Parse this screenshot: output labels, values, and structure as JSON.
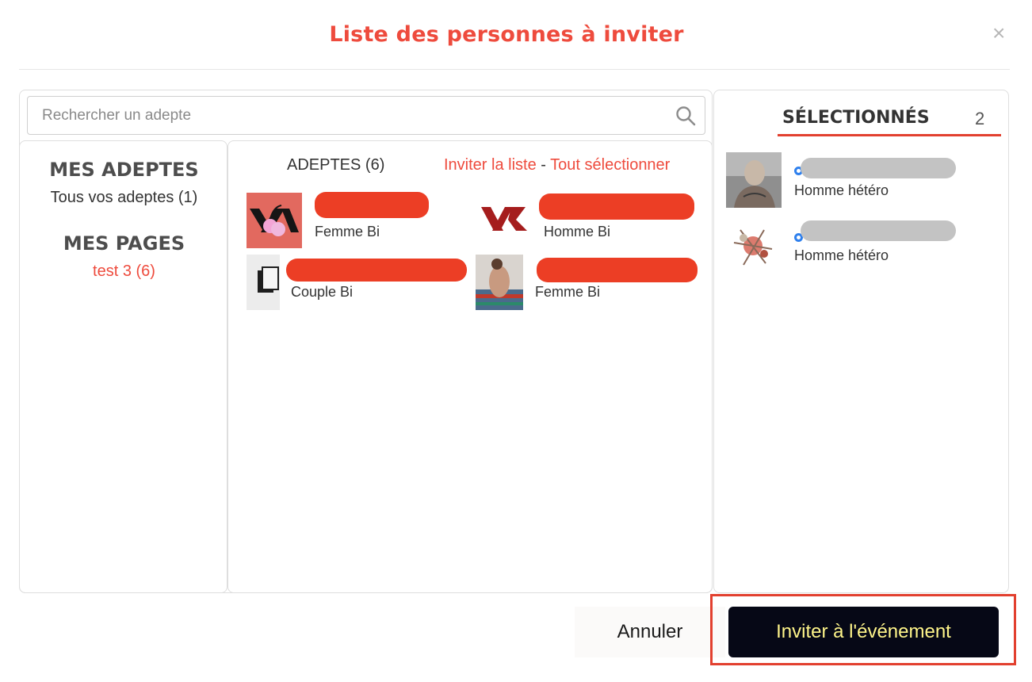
{
  "modal": {
    "title": "Liste des personnes à inviter",
    "close_glyph": "×"
  },
  "search": {
    "placeholder": "Rechercher un adepte",
    "icon": "search-icon"
  },
  "nav": {
    "adeptes_heading": "MES ADEPTES",
    "adeptes_all": "Tous vos adeptes (1)",
    "pages_heading": "MES PAGES",
    "pages_item": "test 3 (6)"
  },
  "adeptes": {
    "count_label": "ADEPTES (6)",
    "invite_list": "Inviter la liste",
    "separator": " - ",
    "select_all": "Tout sélectionner",
    "people": [
      {
        "label": "Femme Bi",
        "name_redacted": true
      },
      {
        "label": "Homme Bi",
        "name_redacted": true
      },
      {
        "label": "Couple Bi",
        "name_redacted": true
      },
      {
        "label": "Femme Bi",
        "name_redacted": true
      }
    ]
  },
  "selected": {
    "title": "SÉLECTIONNÉS",
    "count": "2",
    "people": [
      {
        "label": "Homme hétéro",
        "name_redacted": true
      },
      {
        "label": "Homme hétéro",
        "name_redacted": true
      }
    ]
  },
  "footer": {
    "cancel": "Annuler",
    "invite": "Inviter à l'événement"
  },
  "colors": {
    "accent": "#ee4b3d",
    "invite_button_bg": "#060816",
    "invite_button_text": "#fff58a",
    "online_ring": "#2f80ed"
  }
}
